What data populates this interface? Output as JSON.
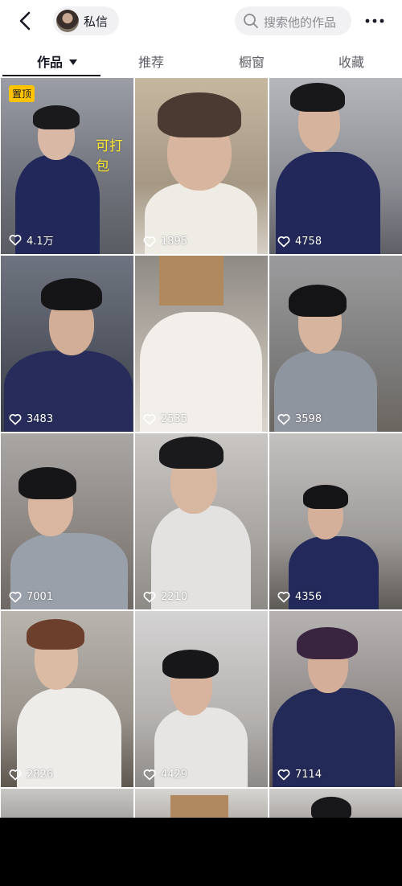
{
  "header": {
    "dm_label": "私信",
    "search_placeholder": "搜索他的作品"
  },
  "tabs": [
    {
      "label": "作品"
    },
    {
      "label": "推荐"
    },
    {
      "label": "橱窗"
    },
    {
      "label": "收藏"
    }
  ],
  "grid": {
    "pinned_label": "置顶",
    "overlay_text": "可打包",
    "items": [
      {
        "likes": "4.1万"
      },
      {
        "likes": "1895"
      },
      {
        "likes": "4758"
      },
      {
        "likes": "3483"
      },
      {
        "likes": "2535"
      },
      {
        "likes": "3598"
      },
      {
        "likes": "7001"
      },
      {
        "likes": "2210"
      },
      {
        "likes": "4356"
      },
      {
        "likes": "2826"
      },
      {
        "likes": "4429"
      },
      {
        "likes": "7114"
      }
    ]
  },
  "colors": {
    "pin_badge": "#ffc300",
    "overlay_text": "#ffe833",
    "active_tab": "#161823"
  }
}
